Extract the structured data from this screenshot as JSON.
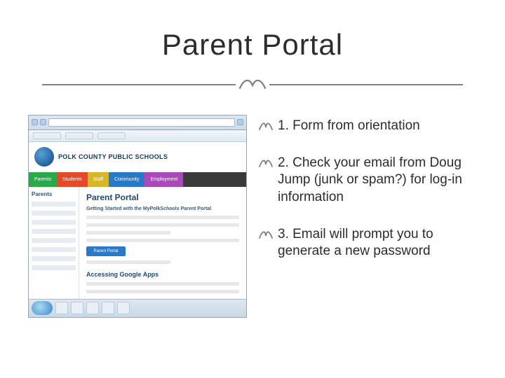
{
  "title": "Parent Portal",
  "bullets": [
    {
      "text": "1. Form from orientation"
    },
    {
      "text": "2. Check your email from Doug Jump (junk or spam?) for log-in information"
    },
    {
      "text": "3. Email will prompt you to generate a new password"
    }
  ],
  "screenshot": {
    "district": "POLK COUNTY PUBLIC SCHOOLS",
    "nav": [
      "Parents",
      "Students",
      "Staff",
      "Community",
      "Employment"
    ],
    "sidebar_heading": "Parents",
    "page_heading": "Parent Portal",
    "page_sub": "Getting Started with the MyPolkSchools Parent Portal",
    "button": "Parent Portal",
    "page_heading2": "Accessing Google Apps"
  }
}
